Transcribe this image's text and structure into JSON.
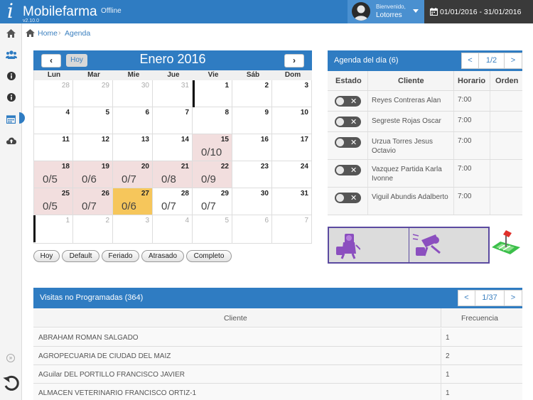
{
  "header": {
    "app_name": "Mobilefarma",
    "version": "v2.10.0",
    "status": "Offline",
    "welcome": "Bienvenido,",
    "username": "Lotorres",
    "date_range": "01/01/2016 - 31/01/2016"
  },
  "sidebar": {
    "items": [
      {
        "icon": "home-icon"
      },
      {
        "icon": "users-icon"
      },
      {
        "icon": "info-icon"
      },
      {
        "icon": "info-icon"
      },
      {
        "icon": "calendar-icon",
        "active": true
      },
      {
        "icon": "cloud-upload-icon"
      }
    ],
    "collapse": "»"
  },
  "breadcrumb": {
    "home": "Home",
    "separator": "›",
    "current": "Agenda"
  },
  "calendar": {
    "today_label": "Hoy",
    "prev": "‹",
    "next": "›",
    "title": "Enero 2016",
    "weekdays": [
      "Lun",
      "Mar",
      "Mie",
      "Jue",
      "Vie",
      "Sáb",
      "Dom"
    ],
    "weeks": [
      [
        {
          "d": "28",
          "dim": true
        },
        {
          "d": "29",
          "dim": true
        },
        {
          "d": "30",
          "dim": true
        },
        {
          "d": "31",
          "dim": true
        },
        {
          "d": "1"
        },
        {
          "d": "2"
        },
        {
          "d": "3"
        }
      ],
      [
        {
          "d": "4"
        },
        {
          "d": "5"
        },
        {
          "d": "6"
        },
        {
          "d": "7"
        },
        {
          "d": "8"
        },
        {
          "d": "9"
        },
        {
          "d": "10"
        }
      ],
      [
        {
          "d": "11"
        },
        {
          "d": "12"
        },
        {
          "d": "13"
        },
        {
          "d": "14"
        },
        {
          "d": "15",
          "c": "0/10",
          "s": "pink"
        },
        {
          "d": "16"
        },
        {
          "d": "17"
        }
      ],
      [
        {
          "d": "18",
          "c": "0/5",
          "s": "pink"
        },
        {
          "d": "19",
          "c": "0/6",
          "s": "pink"
        },
        {
          "d": "20",
          "c": "0/7",
          "s": "pink"
        },
        {
          "d": "21",
          "c": "0/8",
          "s": "pink"
        },
        {
          "d": "22",
          "c": "0/9",
          "s": "pink"
        },
        {
          "d": "23"
        },
        {
          "d": "24"
        }
      ],
      [
        {
          "d": "25",
          "c": "0/5",
          "s": "pink"
        },
        {
          "d": "26",
          "c": "0/7",
          "s": "pink"
        },
        {
          "d": "27",
          "c": "0/6",
          "s": "yellow"
        },
        {
          "d": "28",
          "c": "0/7"
        },
        {
          "d": "29",
          "c": "0/7"
        },
        {
          "d": "30"
        },
        {
          "d": "31"
        }
      ],
      [
        {
          "d": "1",
          "dim": true
        },
        {
          "d": "2",
          "dim": true
        },
        {
          "d": "3",
          "dim": true
        },
        {
          "d": "4",
          "dim": true
        },
        {
          "d": "5",
          "dim": true
        },
        {
          "d": "6",
          "dim": true
        },
        {
          "d": "7",
          "dim": true
        }
      ]
    ],
    "legend": [
      "Hoy",
      "Default",
      "Feriado",
      "Atrasado",
      "Completo"
    ]
  },
  "agenda": {
    "title": "Agenda del día (6)",
    "pager": {
      "prev": "<",
      "page": "1/2",
      "next": ">"
    },
    "columns": [
      "Estado",
      "Cliente",
      "Horario",
      "Orden"
    ],
    "rows": [
      {
        "client": "Reyes Contreras Alan",
        "time": "7:00",
        "order": ""
      },
      {
        "client": "Segreste Rojas Oscar",
        "time": "7:00",
        "order": ""
      },
      {
        "client": "Urzua Torres Jesus Octavio",
        "time": "7:00",
        "order": ""
      },
      {
        "client": "Vazquez Partida Karla Ivonne",
        "time": "7:00",
        "order": ""
      },
      {
        "client": "Viguil Abundis Adalberto",
        "time": "7:00",
        "order": ""
      }
    ]
  },
  "visitas": {
    "title": "Visitas no Programadas (364)",
    "pager": {
      "prev": "<",
      "page": "1/37",
      "next": ">"
    },
    "columns": [
      "Cliente",
      "Frecuencia"
    ],
    "rows": [
      {
        "client": "ABRAHAM ROMAN SALGADO",
        "freq": "1"
      },
      {
        "client": "AGROPECUARIA DE CIUDAD DEL MAIZ",
        "freq": "2"
      },
      {
        "client": "AGuilar DEL PORTILLO FRANCISCO JAVIER",
        "freq": "1"
      },
      {
        "client": "ALMACEN VETERINARIO FRANCISCO ORTIZ-1",
        "freq": "1"
      }
    ]
  },
  "colors": {
    "primary": "#2f7cc2",
    "pending_day": "#f2dede",
    "today": "#f6c65b",
    "tiles_border": "#5b4aa0",
    "tile_icon": "#8b4fbf"
  }
}
